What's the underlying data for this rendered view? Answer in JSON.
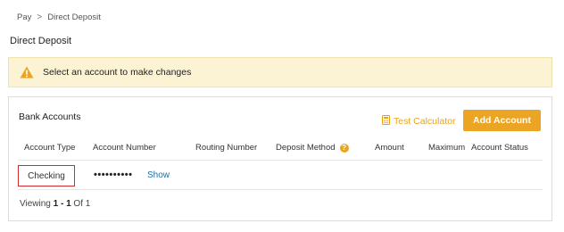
{
  "breadcrumb": {
    "items": [
      "Pay",
      "Direct Deposit"
    ],
    "separator": ">"
  },
  "page_title": "Direct Deposit",
  "alert": {
    "icon": "warning-icon",
    "text": "Select an account to make changes",
    "bg_color": "#fcf3d4"
  },
  "bank_accounts": {
    "title": "Bank Accounts",
    "test_calculator_label": "Test Calculator",
    "add_account_label": "Add Account",
    "accent_color": "#eba423",
    "columns": [
      "Account Type",
      "Account Number",
      "Routing Number",
      "Deposit Method",
      "Amount",
      "Maximum",
      "Account Status"
    ],
    "deposit_method_help": "?",
    "rows": [
      {
        "account_type": "Checking",
        "account_number": "••••••••••",
        "show_label": "Show"
      }
    ],
    "pagination": {
      "prefix": "Viewing",
      "range": "1 - 1",
      "of_label": "Of",
      "total": "1"
    }
  }
}
